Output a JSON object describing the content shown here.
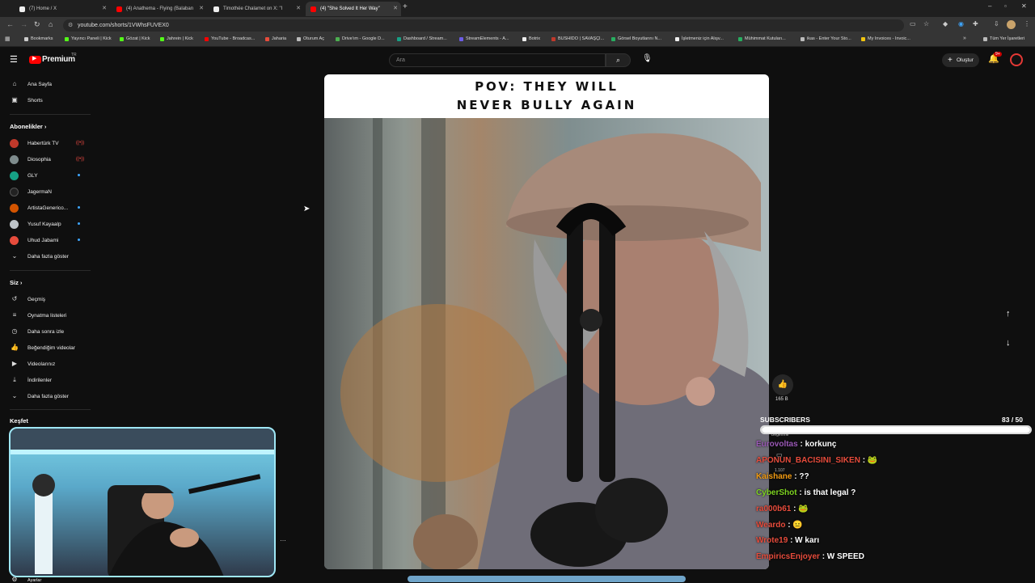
{
  "tabs": [
    {
      "title": "(7) Home / X",
      "color": "#000000"
    },
    {
      "title": "(4) Anathema - Flying (Balaban",
      "color": "#ff0000"
    },
    {
      "title": "Timothée Chalamet on X: \"I",
      "color": "#000000"
    },
    {
      "title": "(4) \"She Solved It Her Way\"",
      "color": "#ff0000"
    }
  ],
  "address": "youtube.com/shorts/1VWhsFUVEX0",
  "bookmarks": [
    "Bookmarks",
    "Yayıncı Paneli | Kick",
    "Gözat | Kick",
    "Jahrein | Kick",
    "YouTube - Broadcas...",
    "Jaharia",
    "Oturum Aç",
    "Drive'ım - Google D...",
    "Dashboard / Stream...",
    "StreamElements - A...",
    "Botrix",
    "BUSHIDO | SAVAŞÇI...",
    "Görsel Boyutlarını N...",
    "İşletmeniz için Alışv...",
    "Mühimmat Kutuları...",
    "ikas - Enter Your Sto...",
    "My Invoices - Invoic...",
    "Tüm Yer İşaretleri"
  ],
  "yt": {
    "logo": "Premium",
    "logo_sup": "TR",
    "search_placeholder": "Ara",
    "create_label": "Oluştur",
    "notif_count": "9+"
  },
  "sidebar": {
    "home": "Ana Sayfa",
    "shorts": "Shorts",
    "subs_title": "Abonelikler",
    "subs": [
      {
        "name": "Habertürk TV",
        "color": "#c0392b",
        "live": true
      },
      {
        "name": "Diosophia",
        "color": "#7f8c8d",
        "live": true
      },
      {
        "name": "GLY",
        "color": "#16a085",
        "live": false
      },
      {
        "name": "JagermaN",
        "color": "#222222",
        "live": false
      },
      {
        "name": "ArtistaGenerico...",
        "color": "#d35400",
        "live": false
      },
      {
        "name": "Yusuf Kayaalp",
        "color": "#bdc3c7",
        "live": false
      },
      {
        "name": "Uhud Jabami",
        "color": "#e74c3c",
        "live": false
      }
    ],
    "more1": "Daha fazla göster",
    "you_title": "Siz",
    "you_items": [
      "Geçmiş",
      "Oynatma listeleri",
      "Daha sonra izle",
      "Beğendiğim videolar",
      "Videolarınız",
      "İndirilenler"
    ],
    "more2": "Daha fazla göster",
    "explore_title": "Keşfet",
    "settings": "Ayarlar"
  },
  "short": {
    "caption_line1": "POV: THEY WILL",
    "caption_line2": "NEVER BULLY AGAIN",
    "likes": "165 B",
    "dislike": "Beğenme",
    "comments": "1.107"
  },
  "chat": {
    "goal_label": "SUBSCRIBERS",
    "goal_value": "83 / 50",
    "goal_fraction": 1.0,
    "lines": [
      {
        "user": "Eurovoltas",
        "text": ": korkunç",
        "color": "#9b59b6"
      },
      {
        "user": "APONUN_BACISINI_SIKEN",
        "text": ": 🐸",
        "color": "#e74c3c"
      },
      {
        "user": "Kaishane",
        "text": ": ??",
        "color": "#f39c12"
      },
      {
        "user": "CyberShot",
        "text": ": is that legal ?",
        "color": "#7ed321"
      },
      {
        "user": "ra000b61",
        "text": ": 🐸",
        "color": "#e74c3c"
      },
      {
        "user": "Weardo",
        "text": ": 😐",
        "color": "#e74c3c"
      },
      {
        "user": "Wrote19",
        "text": ": W karı",
        "color": "#e74c3c"
      },
      {
        "user": "EmpiricsEnjoyer",
        "text": ": W SPEED",
        "color": "#e74c3c"
      }
    ]
  }
}
